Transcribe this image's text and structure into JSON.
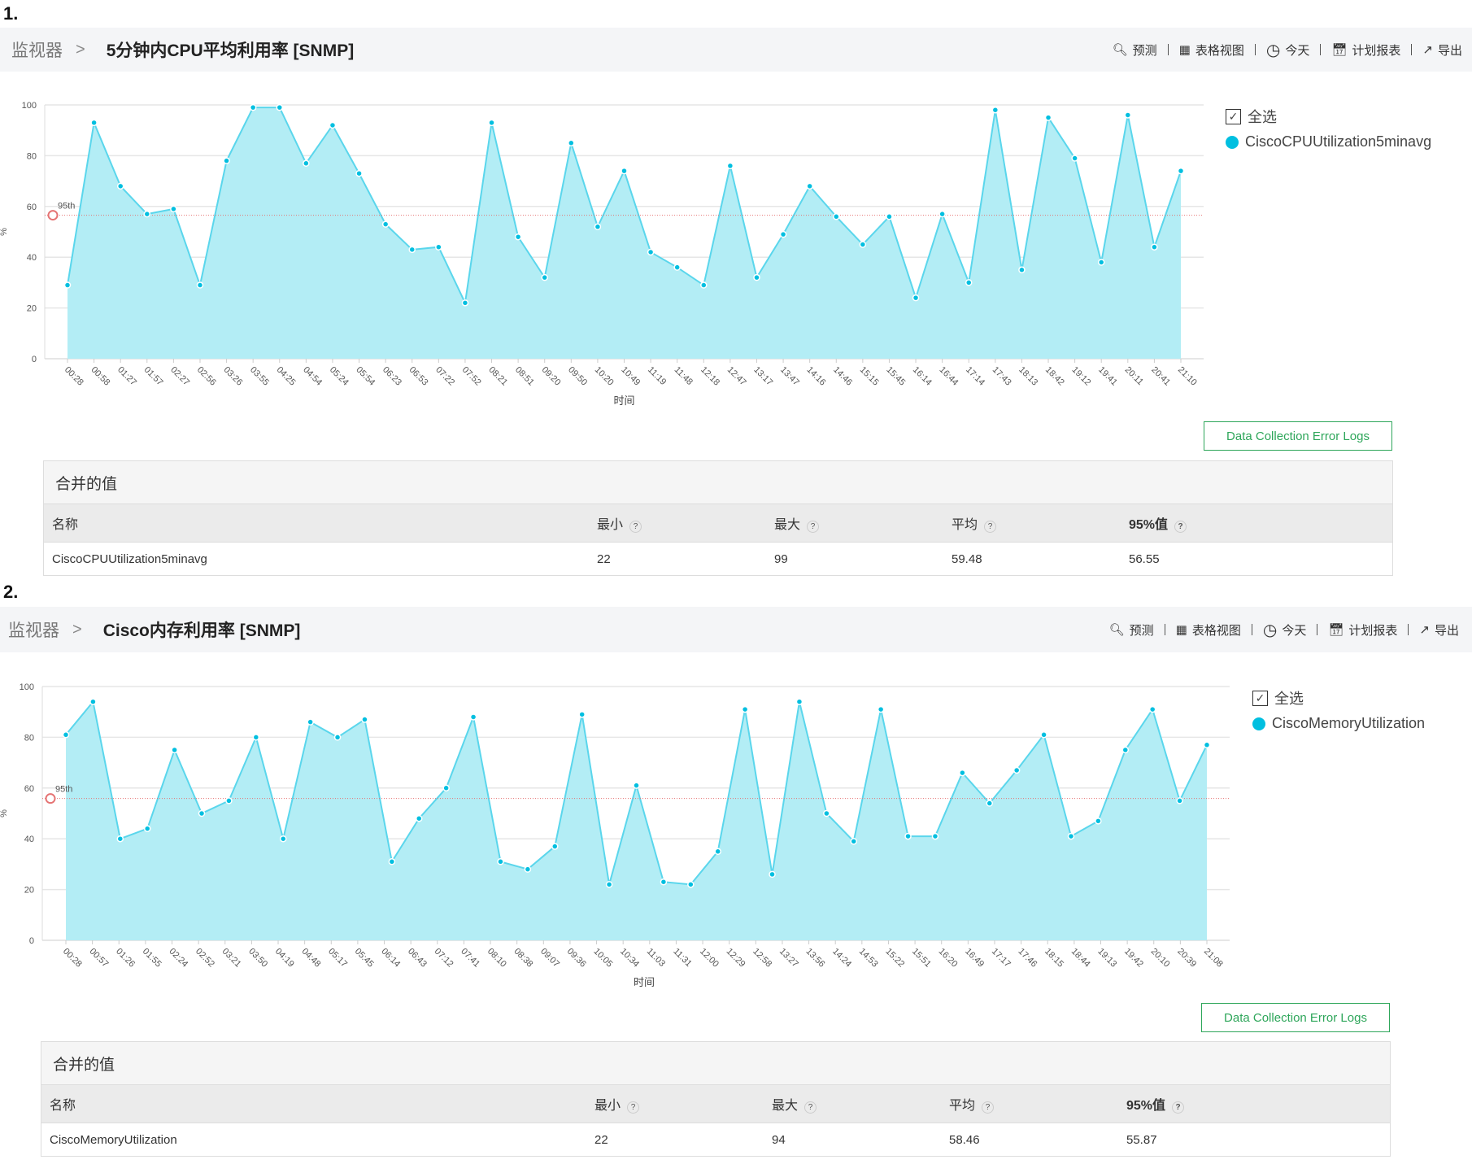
{
  "colors": {
    "series": "#00bfe0",
    "fill": "#b3edf5",
    "percentile": "#e57373",
    "button": "#2ea65a"
  },
  "toolbar": {
    "forecast": "预测",
    "table_view": "表格视图",
    "today": "今天",
    "schedule_report": "计划报表",
    "export": "导出"
  },
  "sections": [
    {
      "number": "1.",
      "breadcrumb_root": "监视器",
      "title": "5分钟内CPU平均利用率 [SNMP]",
      "legend": {
        "select_all": "全选",
        "series_name": "CiscoCPUUtilization5minavg"
      },
      "error_button": "Data Collection Error Logs",
      "table": {
        "title": "合并的值",
        "headers": [
          "名称",
          "最小",
          "最大",
          "平均",
          "95%值"
        ],
        "rows": [
          [
            "CiscoCPUUtilization5minavg",
            "22",
            "99",
            "59.48",
            "56.55"
          ]
        ]
      }
    },
    {
      "number": "2.",
      "breadcrumb_root": "监视器",
      "title": "Cisco内存利用率 [SNMP]",
      "legend": {
        "select_all": "全选",
        "series_name": "CiscoMemoryUtilization"
      },
      "error_button": "Data Collection Error Logs",
      "table": {
        "title": "合并的值",
        "headers": [
          "名称",
          "最小",
          "最大",
          "平均",
          "95%值"
        ],
        "rows": [
          [
            "CiscoMemoryUtilization",
            "22",
            "94",
            "58.46",
            "55.87"
          ]
        ]
      }
    }
  ],
  "chart_data": [
    {
      "type": "area",
      "title": "5分钟内CPU平均利用率 [SNMP]",
      "xlabel": "时间",
      "ylabel": "%",
      "ylim": [
        0,
        100
      ],
      "yticks": [
        0,
        20,
        40,
        60,
        80,
        100
      ],
      "grid": true,
      "legend": "right",
      "percentile_line": {
        "label": "95th",
        "value": 56.55
      },
      "x": [
        "00:28",
        "00:58",
        "01:27",
        "01:57",
        "02:27",
        "02:56",
        "03:26",
        "03:55",
        "04:25",
        "04:54",
        "05:24",
        "05:54",
        "06:23",
        "06:53",
        "07:22",
        "07:52",
        "08:21",
        "08:51",
        "09:20",
        "09:50",
        "10:20",
        "10:49",
        "11:19",
        "11:48",
        "12:18",
        "12:47",
        "13:17",
        "13:47",
        "14:16",
        "14:46",
        "15:15",
        "15:45",
        "16:14",
        "16:44",
        "17:14",
        "17:43",
        "18:13",
        "18:42",
        "19:12",
        "19:41",
        "20:11",
        "20:41",
        "21:10"
      ],
      "series": [
        {
          "name": "CiscoCPUUtilization5minavg",
          "values": [
            29,
            93,
            68,
            57,
            59,
            29,
            78,
            99,
            99,
            77,
            92,
            73,
            53,
            43,
            44,
            22,
            93,
            48,
            32,
            85,
            52,
            74,
            42,
            36,
            29,
            76,
            32,
            49,
            68,
            56,
            45,
            56,
            24,
            57,
            30,
            98,
            35,
            95,
            79,
            38,
            96,
            44,
            74
          ]
        }
      ]
    },
    {
      "type": "area",
      "title": "Cisco内存利用率 [SNMP]",
      "xlabel": "时间",
      "ylabel": "%",
      "ylim": [
        0,
        100
      ],
      "yticks": [
        0,
        20,
        40,
        60,
        80,
        100
      ],
      "grid": true,
      "legend": "right",
      "percentile_line": {
        "label": "95th",
        "value": 55.87
      },
      "x": [
        "00:28",
        "00:57",
        "01:26",
        "01:55",
        "02:24",
        "02:52",
        "03:21",
        "03:50",
        "04:19",
        "04:48",
        "05:17",
        "05:45",
        "06:14",
        "06:43",
        "07:12",
        "07:41",
        "08:10",
        "08:38",
        "09:07",
        "09:36",
        "10:05",
        "10:34",
        "11:03",
        "11:31",
        "12:00",
        "12:29",
        "12:58",
        "13:27",
        "13:56",
        "14:24",
        "14:53",
        "15:22",
        "15:51",
        "16:20",
        "16:49",
        "17:17",
        "17:46",
        "18:15",
        "18:44",
        "19:13",
        "19:42",
        "20:10",
        "20:39",
        "21:08"
      ],
      "series": [
        {
          "name": "CiscoMemoryUtilization",
          "values": [
            81,
            94,
            40,
            44,
            75,
            50,
            55,
            80,
            40,
            86,
            80,
            87,
            31,
            48,
            60,
            88,
            31,
            28,
            37,
            89,
            22,
            61,
            23,
            22,
            35,
            91,
            26,
            94,
            50,
            39,
            91,
            41,
            41,
            66,
            54,
            67,
            81,
            41,
            47,
            75,
            91,
            55,
            77
          ]
        }
      ]
    }
  ]
}
